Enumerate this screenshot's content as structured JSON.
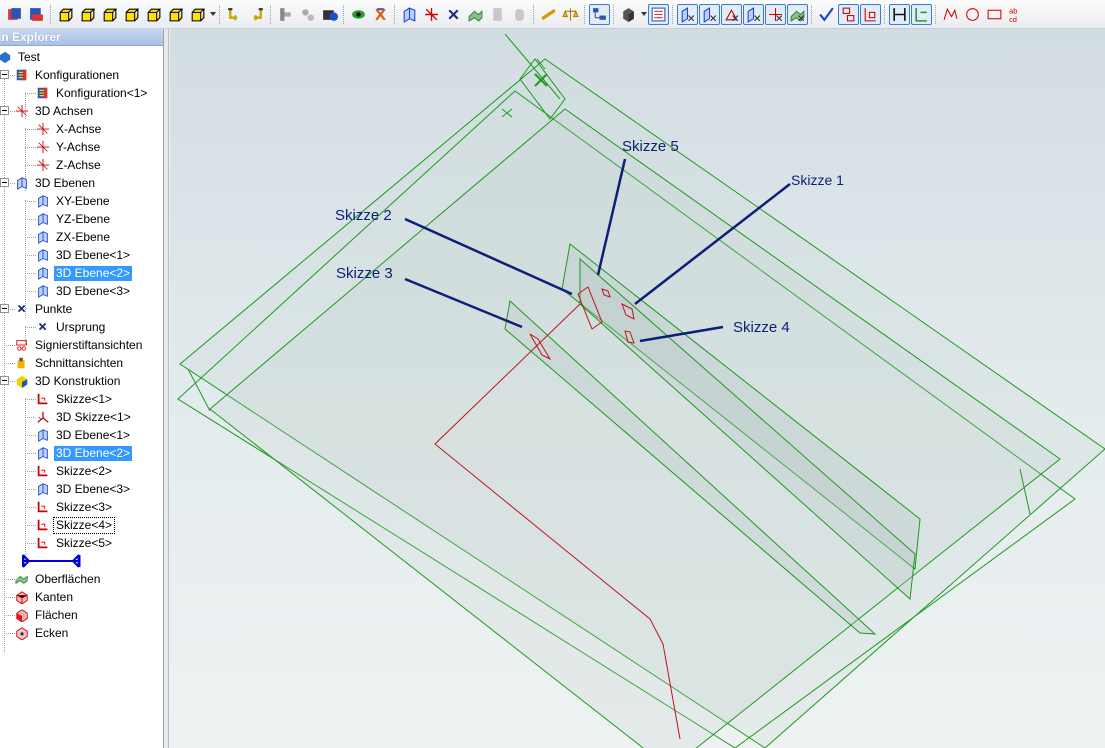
{
  "explorer": {
    "title": "gn Explorer",
    "tree": [
      {
        "id": "root",
        "label": "Test",
        "icon": "part-icon"
      },
      {
        "id": "konfig",
        "label": "Konfigurationen",
        "icon": "configuration-icon"
      },
      {
        "id": "konfig1",
        "label": "Konfiguration<1>",
        "icon": "configuration-icon"
      },
      {
        "id": "achsen",
        "label": "3D Achsen",
        "icon": "axis-icon"
      },
      {
        "id": "xachse",
        "label": "X-Achse",
        "icon": "axis-icon"
      },
      {
        "id": "yachse",
        "label": "Y-Achse",
        "icon": "axis-icon"
      },
      {
        "id": "zachse",
        "label": "Z-Achse",
        "icon": "axis-icon"
      },
      {
        "id": "ebenen",
        "label": "3D Ebenen",
        "icon": "plane-icon"
      },
      {
        "id": "xy",
        "label": "XY-Ebene",
        "icon": "plane-icon"
      },
      {
        "id": "yz",
        "label": "YZ-Ebene",
        "icon": "plane-icon"
      },
      {
        "id": "zx",
        "label": "ZX-Ebene",
        "icon": "plane-icon"
      },
      {
        "id": "e1",
        "label": "3D Ebene<1>",
        "icon": "plane-icon"
      },
      {
        "id": "e2",
        "label": "3D Ebene<2>",
        "icon": "plane-icon"
      },
      {
        "id": "e3",
        "label": "3D Ebene<3>",
        "icon": "plane-icon"
      },
      {
        "id": "punkte",
        "label": "Punkte",
        "icon": "point-icon"
      },
      {
        "id": "ursprung",
        "label": "Ursprung",
        "icon": "point-icon"
      },
      {
        "id": "signier",
        "label": "Signierstiftansichten",
        "icon": "markup-pen-icon"
      },
      {
        "id": "schnitt",
        "label": "Schnittansichten",
        "icon": "section-view-icon"
      },
      {
        "id": "konstr",
        "label": "3D Konstruktion",
        "icon": "construction-icon"
      },
      {
        "id": "s1",
        "label": "Skizze<1>",
        "icon": "sketch-icon"
      },
      {
        "id": "s3d1",
        "label": "3D Skizze<1>",
        "icon": "sketch-3d-icon"
      },
      {
        "id": "ke1",
        "label": "3D Ebene<1>",
        "icon": "plane-icon"
      },
      {
        "id": "ke2",
        "label": "3D Ebene<2>",
        "icon": "plane-icon"
      },
      {
        "id": "s2",
        "label": "Skizze<2>",
        "icon": "sketch-icon"
      },
      {
        "id": "ke3",
        "label": "3D Ebene<3>",
        "icon": "plane-icon"
      },
      {
        "id": "s3",
        "label": "Skizze<3>",
        "icon": "sketch-icon"
      },
      {
        "id": "s4",
        "label": "Skizze<4>",
        "icon": "sketch-icon"
      },
      {
        "id": "s5",
        "label": "Skizze<5>",
        "icon": "sketch-icon"
      },
      {
        "id": "rollback",
        "label": "",
        "icon": "rollback-bar-icon"
      },
      {
        "id": "oberfl",
        "label": "Oberflächen",
        "icon": "surface-icon"
      },
      {
        "id": "kanten",
        "label": "Kanten",
        "icon": "edge-icon"
      },
      {
        "id": "flaechen",
        "label": "Flächen",
        "icon": "face-icon"
      },
      {
        "id": "ecken",
        "label": "Ecken",
        "icon": "vertex-icon"
      }
    ]
  },
  "callouts": {
    "skizze1": "Skizze 1",
    "skizze2": "Skizze 2",
    "skizze3": "Skizze 3",
    "skizze4": "Skizze 4",
    "skizze5": "Skizze 5"
  },
  "colors": {
    "selection": "#3399ff",
    "geometry": "#1e9a1e",
    "sketch": "#c0141c",
    "callout": "#0d1f78",
    "rollback": "#0000d0"
  },
  "toolbar_icons": [
    "explorer-icon",
    "explorer-config-icon",
    "view-front-icon",
    "view-back-icon",
    "view-left-icon",
    "view-right-icon",
    "view-top-icon",
    "view-iso-icon",
    "undo-arrow-icon",
    "redo-arrow-icon",
    "print-icon",
    "sign-icon",
    "hide-show-icon",
    "eye-refresh-icon",
    "regen-icon",
    "plane-icon",
    "axis-icon",
    "point-icon",
    "surface-icon",
    "gray-box-icon",
    "gray-box-2-icon",
    "measure-icon",
    "balance-icon",
    "tree-icon",
    "shaded-cube-icon",
    "cfg-a-icon",
    "cfg-b-icon",
    "cfg-c-icon",
    "cfg-d-icon",
    "cfg-e-icon",
    "cfg-f-icon",
    "cfg-g-icon",
    "check-icon",
    "pair-red-icon",
    "pair-red-2-icon",
    "span-icon",
    "split-icon",
    "red-line-icon",
    "red-circle-icon",
    "red-rect-icon",
    "red-text-icon"
  ]
}
